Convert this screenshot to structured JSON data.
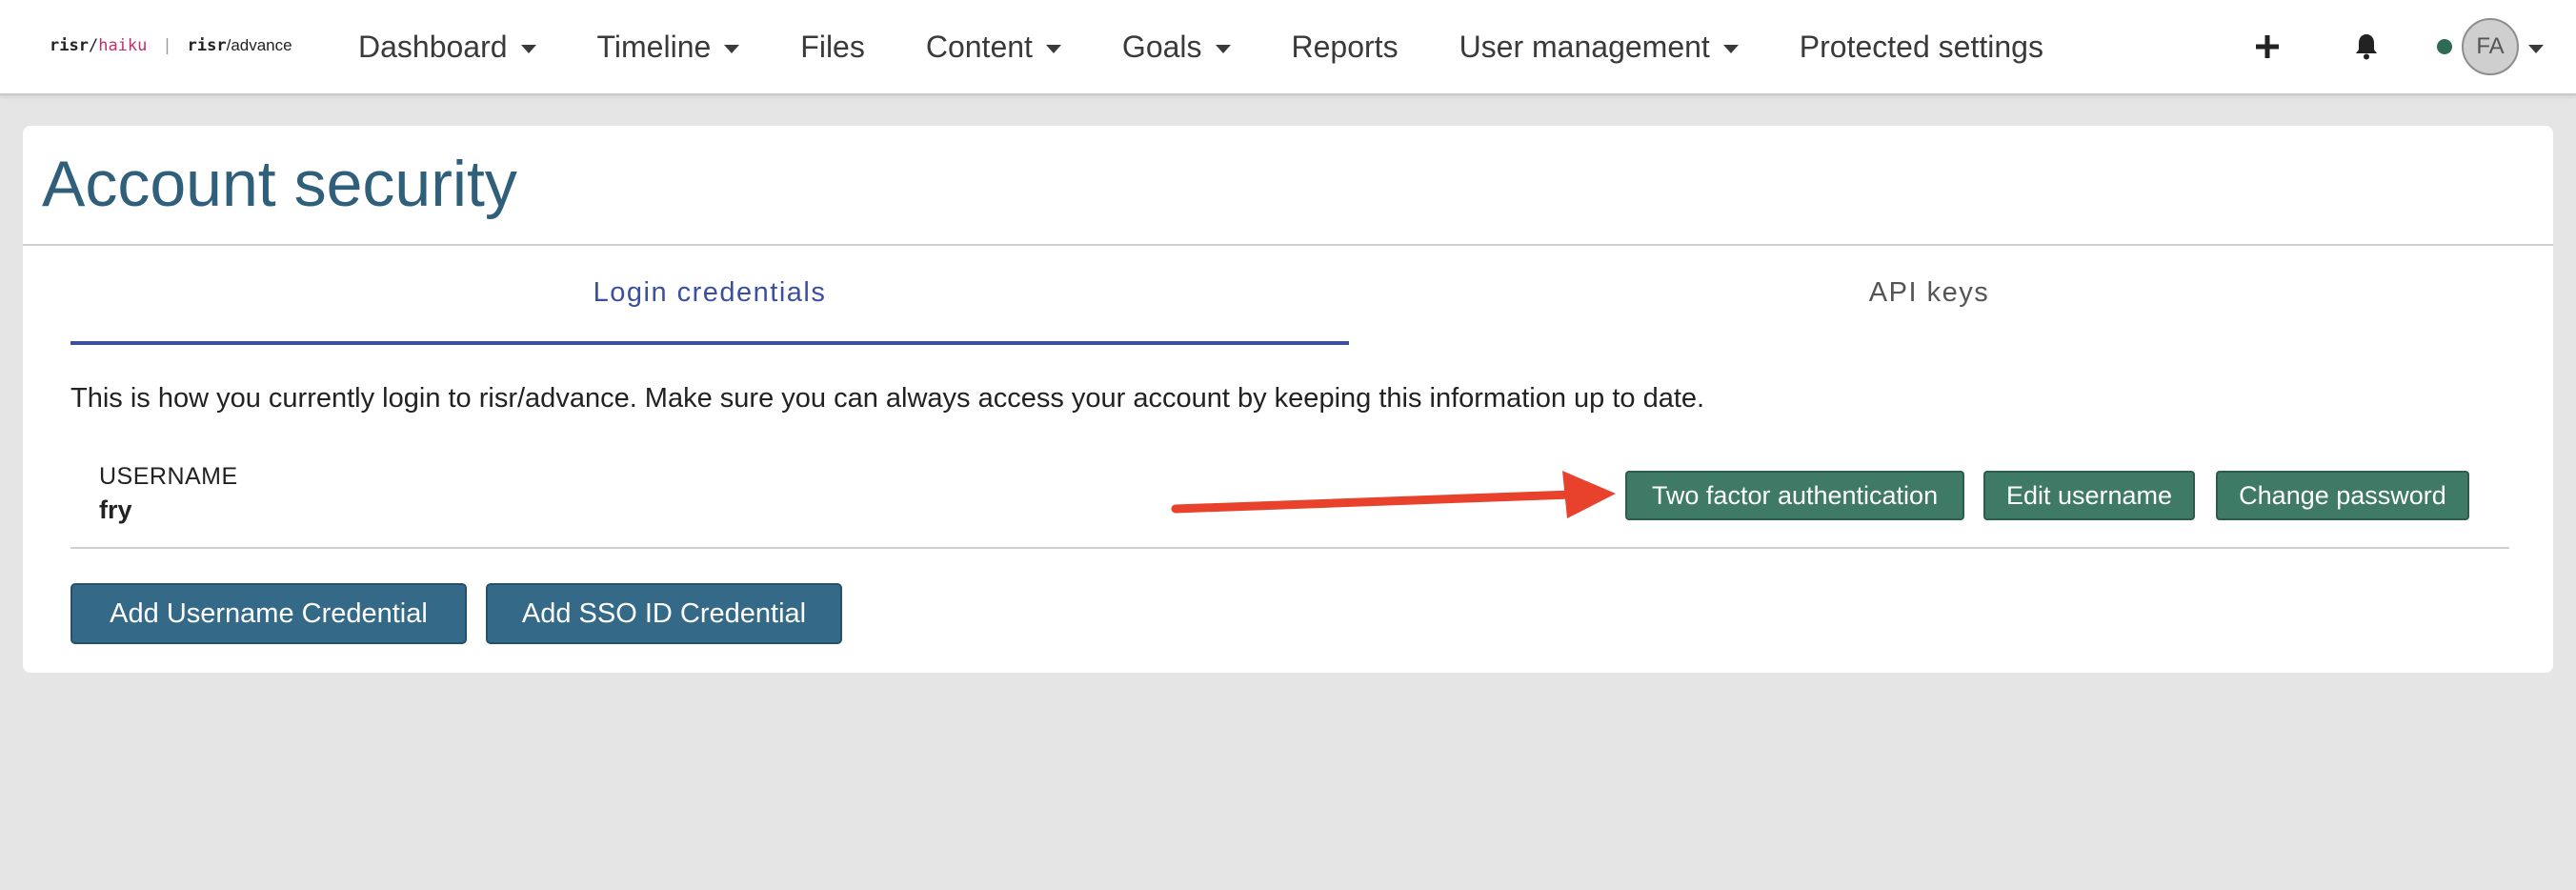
{
  "logo": {
    "part1_bold": "risr",
    "part1_slash": "/",
    "part1_product": "haiku",
    "separator": "|",
    "part2_bold": "risr",
    "part2_rest": "/advance"
  },
  "nav": {
    "items": [
      {
        "label": "Dashboard",
        "dropdown": true
      },
      {
        "label": "Timeline",
        "dropdown": true
      },
      {
        "label": "Files",
        "dropdown": false
      },
      {
        "label": "Content",
        "dropdown": true
      },
      {
        "label": "Goals",
        "dropdown": true
      },
      {
        "label": "Reports",
        "dropdown": false
      },
      {
        "label": "User management",
        "dropdown": true
      },
      {
        "label": "Protected settings",
        "dropdown": false
      }
    ],
    "add_icon": "plus-icon",
    "bell_icon": "bell-icon",
    "user_initials": "FA",
    "status_color": "#2e6a54"
  },
  "page": {
    "title": "Account security",
    "tabs": [
      {
        "label": "Login credentials",
        "active": true
      },
      {
        "label": "API keys",
        "active": false
      }
    ],
    "intro": "This is how you currently login to risr/advance. Make sure you can always access your account by keeping this information up to date.",
    "credential": {
      "label": "USERNAME",
      "value": "fry",
      "buttons": {
        "two_factor": "Two factor authentication",
        "edit_username": "Edit username",
        "change_password": "Change password"
      }
    },
    "actions": {
      "add_username": "Add Username Credential",
      "add_sso": "Add SSO ID Credential"
    }
  },
  "colors": {
    "accent_blue": "#3a4fa0",
    "title_blue": "#2f5f7a",
    "green_button": "#3f7a66",
    "blue_button": "#346a88",
    "annotation_arrow": "#e8412c",
    "logo_haiku": "#c0306a"
  }
}
